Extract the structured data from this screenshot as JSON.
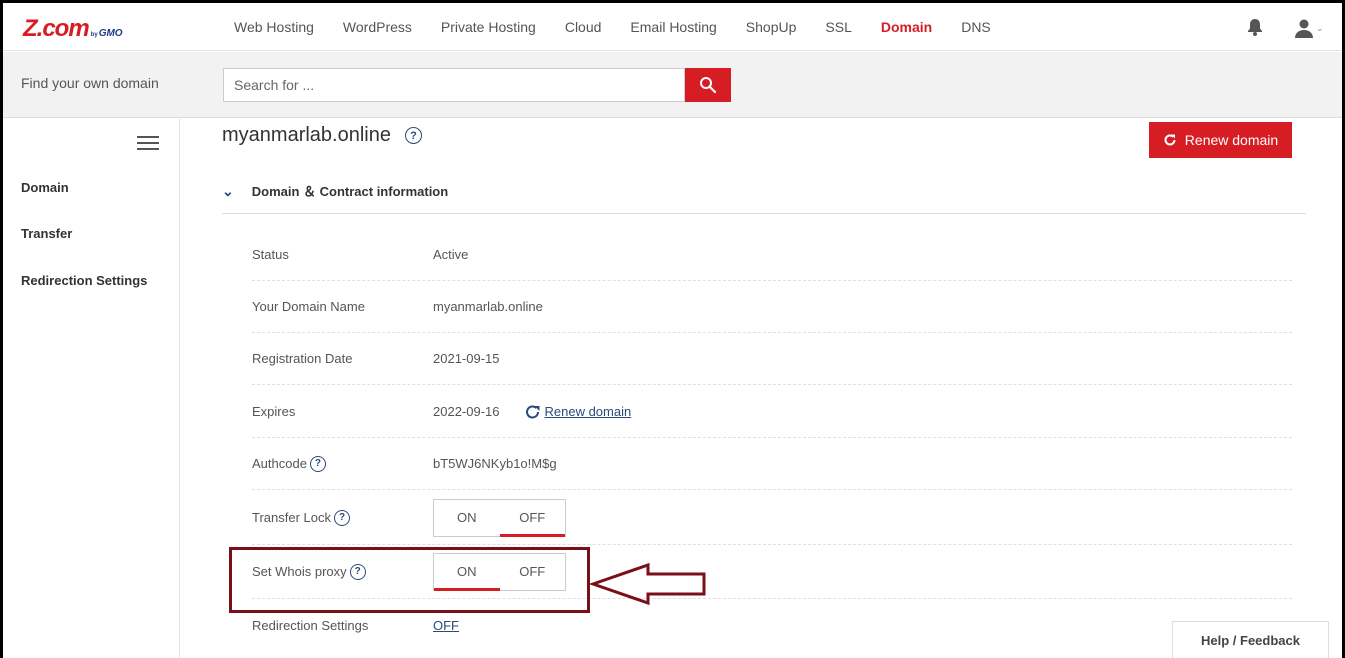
{
  "brand": {
    "logo_main": "Z.com",
    "logo_by": "by",
    "logo_gmo": "GMO",
    "accent": "#d71d24"
  },
  "nav": {
    "items": [
      {
        "label": "Web Hosting"
      },
      {
        "label": "WordPress"
      },
      {
        "label": "Private Hosting"
      },
      {
        "label": "Cloud"
      },
      {
        "label": "Email Hosting"
      },
      {
        "label": "ShopUp"
      },
      {
        "label": "SSL"
      },
      {
        "label": "Domain",
        "active": true
      },
      {
        "label": "DNS"
      }
    ],
    "icons": [
      "bell-icon",
      "user-icon"
    ]
  },
  "search": {
    "label": "Find your own domain",
    "placeholder": "Search for ..."
  },
  "sidebar": {
    "items": [
      {
        "label": "Domain"
      },
      {
        "label": "Transfer"
      },
      {
        "label": "Redirection Settings"
      }
    ]
  },
  "main": {
    "domain_title": "myanmarlab.online",
    "renew_button": "Renew domain",
    "section_title": "Domain ＆ Contract information",
    "rows": {
      "status": {
        "label": "Status",
        "value": "Active"
      },
      "domain_name": {
        "label": "Your Domain Name",
        "value": "myanmarlab.online"
      },
      "registration": {
        "label": "Registration Date",
        "value": "2021-09-15"
      },
      "expires": {
        "label": "Expires",
        "value": "2022-09-16",
        "link": "Renew domain"
      },
      "authcode": {
        "label": "Authcode",
        "value": "bT5WJ6NKyb1o!M$g"
      },
      "transfer_lock": {
        "label": "Transfer Lock",
        "on": "ON",
        "off": "OFF",
        "selected": "OFF"
      },
      "whois_proxy": {
        "label": "Set Whois proxy",
        "on": "ON",
        "off": "OFF",
        "selected": "ON"
      },
      "redirection": {
        "label": "Redirection Settings",
        "value": "OFF"
      }
    }
  },
  "help": {
    "label": "Help / Feedback"
  },
  "annotation": {
    "highlight_color": "#7a0f1a"
  }
}
